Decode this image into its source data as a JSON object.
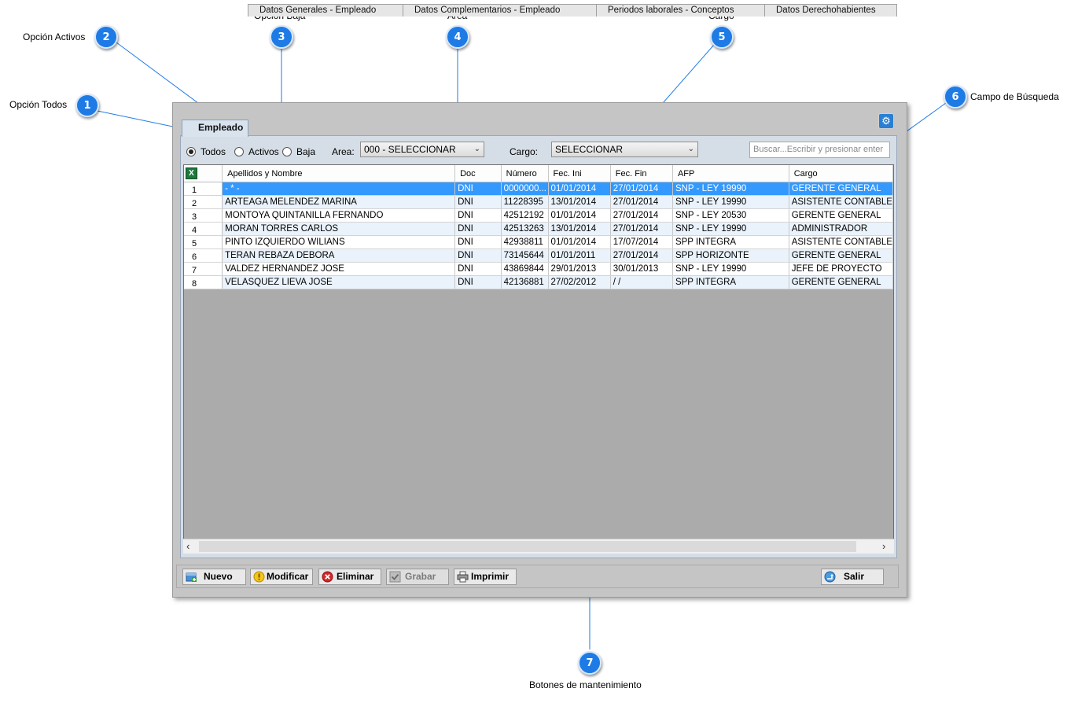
{
  "callouts": [
    {
      "number": "1",
      "label": "Opción Todos"
    },
    {
      "number": "2",
      "label": "Opción Activos"
    },
    {
      "number": "3",
      "label": "Opción Baja"
    },
    {
      "number": "4",
      "label": "Área"
    },
    {
      "number": "5",
      "label": "Cargo"
    },
    {
      "number": "6",
      "label": "Campo de Búsqueda"
    },
    {
      "number": "7",
      "label": "Botones de mantenimiento"
    }
  ],
  "tabs": [
    {
      "label": "Empleado",
      "active": true
    },
    {
      "label": "Datos Generales - Empleado"
    },
    {
      "label": "Datos Complementarios - Empleado"
    },
    {
      "label": "Periodos laborales - Conceptos"
    },
    {
      "label": "Datos Derechohabientes"
    }
  ],
  "filters": {
    "radio_todos": "Todos",
    "radio_activos": "Activos",
    "radio_baja": "Baja",
    "selected_radio": "Todos",
    "area_label": "Area:",
    "area_value": "000 - SELECCIONAR",
    "cargo_label": "Cargo:",
    "cargo_value": "SELECCIONAR",
    "search_placeholder": "Buscar...Escribir y presionar enter"
  },
  "grid": {
    "columns": [
      "Apellidos y Nombre",
      "Doc",
      "Número",
      "Fec. Ini",
      "Fec. Fin",
      "AFP",
      "Cargo"
    ],
    "selected_row": 1,
    "rows": [
      [
        "1",
        "- * -",
        "DNI",
        "0000000...",
        "01/01/2014",
        "27/01/2014",
        "SNP - LEY 19990",
        "GERENTE GENERAL"
      ],
      [
        "2",
        "ARTEAGA MELENDEZ MARINA",
        "DNI",
        "11228395",
        "13/01/2014",
        "27/01/2014",
        "SNP - LEY 19990",
        "ASISTENTE CONTABLE"
      ],
      [
        "3",
        "MONTOYA QUINTANILLA FERNANDO",
        "DNI",
        "42512192",
        "01/01/2014",
        "27/01/2014",
        "SNP - LEY 20530",
        "GERENTE GENERAL"
      ],
      [
        "4",
        "MORAN TORRES CARLOS",
        "DNI",
        "42513263",
        "13/01/2014",
        "27/01/2014",
        "SNP - LEY 19990",
        "ADMINISTRADOR"
      ],
      [
        "5",
        "PINTO IZQUIERDO WILIANS",
        "DNI",
        "42938811",
        "01/01/2014",
        "17/07/2014",
        "SPP INTEGRA",
        "ASISTENTE CONTABLE"
      ],
      [
        "6",
        "TERAN REBAZA DEBORA",
        "DNI",
        "73145644",
        "01/01/2011",
        "27/01/2014",
        "SPP HORIZONTE",
        "GERENTE GENERAL"
      ],
      [
        "7",
        "VALDEZ HERNANDEZ JOSE",
        "DNI",
        "43869844",
        "29/01/2013",
        "30/01/2013",
        "SNP - LEY 19990",
        "JEFE DE PROYECTO"
      ],
      [
        "8",
        "VELASQUEZ LIEVA JOSE",
        "DNI",
        "42136881",
        "27/02/2012",
        " / /",
        "SPP INTEGRA",
        "GERENTE GENERAL"
      ]
    ]
  },
  "toolbar": {
    "nuevo": "Nuevo",
    "modificar": "Modificar",
    "eliminar": "Eliminar",
    "grabar": "Grabar",
    "imprimir": "Imprimir",
    "salir": "Salir"
  },
  "icons": {
    "excel": "excel-icon",
    "gear": "gear-icon",
    "nuevo": "add-icon",
    "modificar": "warning-icon",
    "eliminar": "delete-icon",
    "grabar": "check-icon",
    "imprimir": "printer-icon",
    "salir": "exit-icon"
  },
  "colors": {
    "callout": "#1e7be6",
    "selection": "#3399ff",
    "alt_row": "#eaf3fc"
  }
}
